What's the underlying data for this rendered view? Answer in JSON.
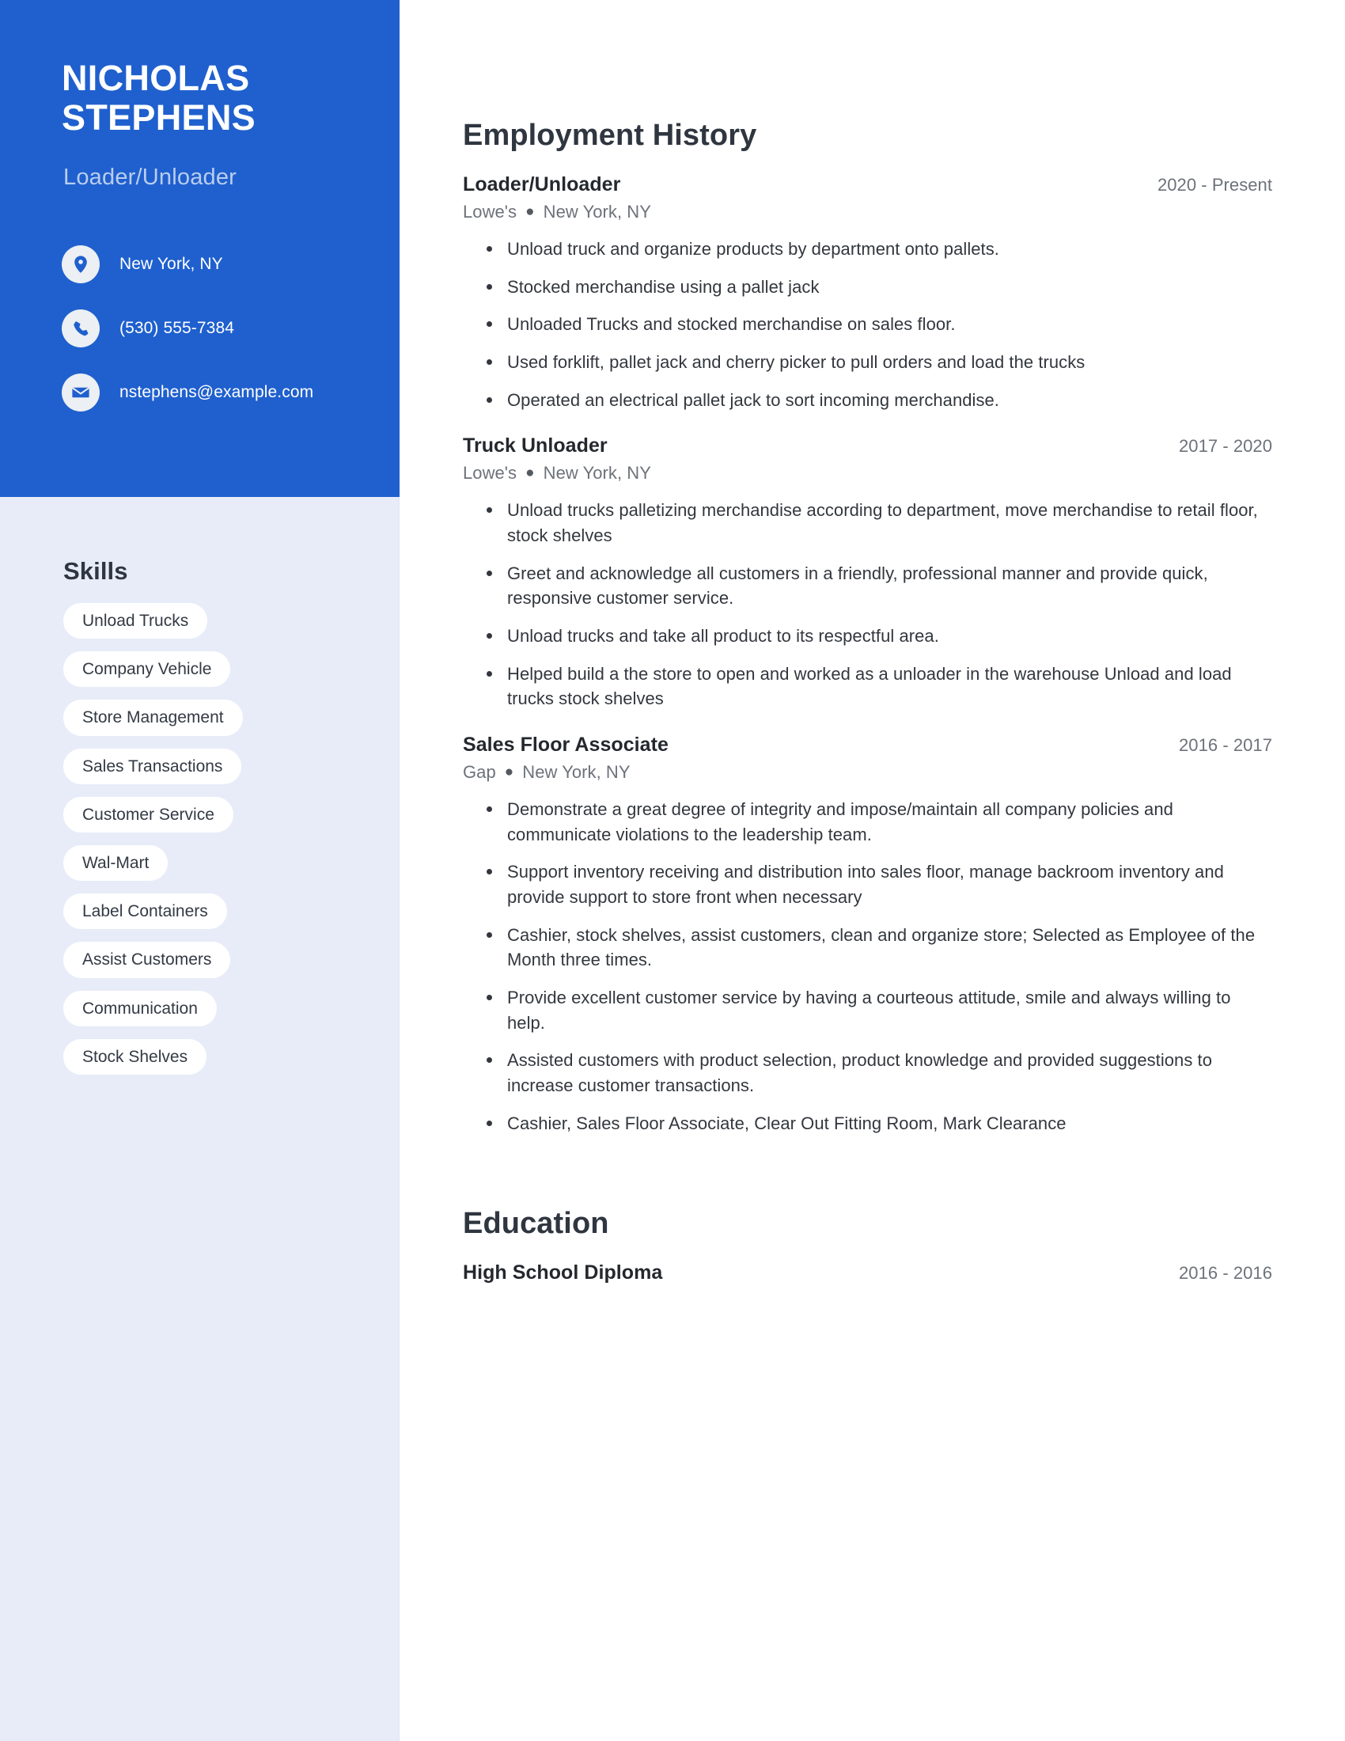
{
  "profile": {
    "first_name": "NICHOLAS",
    "last_name": "STEPHENS",
    "headline": "Loader/Unloader"
  },
  "contact": {
    "items": [
      {
        "icon": "location-pin-icon",
        "value": "New York, NY"
      },
      {
        "icon": "phone-icon",
        "value": "(530) 555-7384"
      },
      {
        "icon": "envelope-icon",
        "value": "nstephens@example.com"
      }
    ]
  },
  "skills": {
    "heading": "Skills",
    "items": [
      "Unload Trucks",
      "Company Vehicle",
      "Store Management",
      "Sales Transactions",
      "Customer Service",
      "Wal-Mart",
      "Label Containers",
      "Assist Customers",
      "Communication",
      "Stock Shelves"
    ]
  },
  "employment": {
    "heading": "Employment History",
    "entries": [
      {
        "title": "Loader/Unloader",
        "dates": "2020 - Present",
        "company": "Lowe's",
        "location": "New York, NY",
        "bullets": [
          "Unload truck and organize products by department onto pallets.",
          "Stocked merchandise using a pallet jack",
          "Unloaded Trucks and stocked merchandise on sales floor.",
          "Used forklift, pallet jack and cherry picker to pull orders and load the trucks",
          "Operated an electrical pallet jack to sort incoming merchandise."
        ]
      },
      {
        "title": "Truck Unloader",
        "dates": "2017 - 2020",
        "company": "Lowe's",
        "location": "New York, NY",
        "bullets": [
          "Unload trucks palletizing merchandise according to department, move merchandise to retail floor, stock shelves",
          "Greet and acknowledge all customers in a friendly, professional manner and provide quick, responsive customer service.",
          "Unload trucks and take all product to its respectful area.",
          "Helped build a the store to open and worked as a unloader in the warehouse Unload and load trucks stock shelves"
        ]
      },
      {
        "title": "Sales Floor Associate",
        "dates": "2016 - 2017",
        "company": "Gap",
        "location": "New York, NY",
        "bullets": [
          "Demonstrate a great degree of integrity and impose/maintain all company policies and communicate violations to the leadership team.",
          "Support inventory receiving and distribution into sales floor, manage backroom inventory and provide support to store front when necessary",
          "Cashier, stock shelves, assist customers, clean and organize store; Selected as Employee of the Month three times.",
          "Provide excellent customer service by having a courteous attitude, smile and always willing to help.",
          "Assisted customers with product selection, product knowledge and provided suggestions to increase customer transactions.",
          "Cashier, Sales Floor Associate, Clear Out Fitting Room, Mark Clearance"
        ]
      }
    ]
  },
  "education": {
    "heading": "Education",
    "entries": [
      {
        "title": "High School Diploma",
        "dates": "2016 - 2016"
      }
    ]
  },
  "theme": {
    "accent": "#1f60ce",
    "sidebar_bg": "#e7ecf8",
    "pill_bg": "#ffffff",
    "heading_color": "#2f3640",
    "muted_text": "#6d7279"
  }
}
